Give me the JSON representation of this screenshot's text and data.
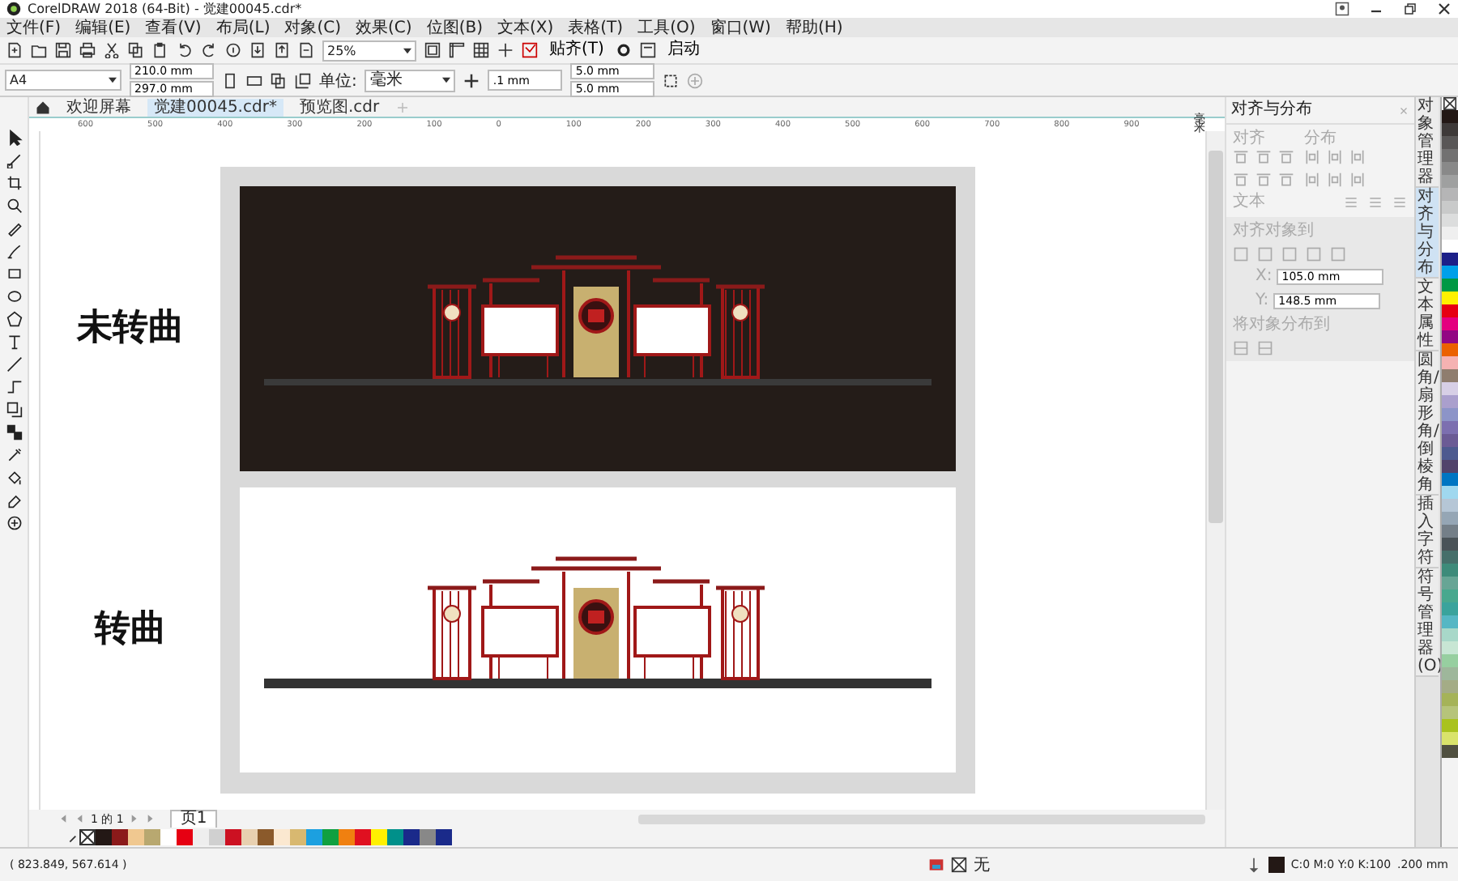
{
  "window": {
    "title": "CorelDRAW 2018 (64-Bit) - 觉建00045.cdr*"
  },
  "menu": [
    "文件(F)",
    "编辑(E)",
    "查看(V)",
    "布局(L)",
    "对象(C)",
    "效果(C)",
    "位图(B)",
    "文本(X)",
    "表格(T)",
    "工具(O)",
    "窗口(W)",
    "帮助(H)"
  ],
  "toolbar": {
    "zoom": "25%",
    "snap": "贴齐(T)",
    "launch": "启动"
  },
  "property_bar": {
    "page_size": "A4",
    "width": "210.0 mm",
    "height": "297.0 mm",
    "units_label": "单位:",
    "units": "毫米",
    "nudge": ".1 mm",
    "dup_x": "5.0 mm",
    "dup_y": "5.0 mm"
  },
  "doc_tabs": [
    {
      "label": "欢迎屏幕",
      "selected": false
    },
    {
      "label": "觉建00045.cdr*",
      "selected": true
    },
    {
      "label": "预览图.cdr",
      "selected": false
    }
  ],
  "ruler": {
    "labels": [
      "600",
      "500",
      "400",
      "300",
      "200",
      "100",
      "0",
      "100",
      "200",
      "300",
      "400",
      "500",
      "600",
      "700",
      "800",
      "900"
    ],
    "unit": "毫米"
  },
  "canvas": {
    "panels": [
      {
        "kind": "dark",
        "label": "未转曲"
      },
      {
        "kind": "light",
        "label": "转曲"
      }
    ]
  },
  "page_nav": {
    "count": "1 的 1",
    "page_tab": "页1"
  },
  "palette": [
    {
      "color": "#231815"
    },
    {
      "color": "#8b1a1a"
    },
    {
      "color": "#f0c890"
    },
    {
      "color": "#b8a870"
    },
    {
      "color": "#ffffff"
    },
    {
      "color": "#e60012"
    },
    {
      "color": "#eeeeee"
    },
    {
      "color": "#d0d0d0"
    },
    {
      "color": "#cc1122"
    },
    {
      "color": "#e8d0b0"
    },
    {
      "color": "#8b5a2b"
    },
    {
      "color": "#fbe8d0"
    },
    {
      "color": "#d8b870"
    },
    {
      "color": "#1ca0e0"
    },
    {
      "color": "#10a040"
    },
    {
      "color": "#f08010"
    },
    {
      "color": "#e01020"
    },
    {
      "color": "#fff000"
    },
    {
      "color": "#00908a"
    },
    {
      "color": "#1a2a8a"
    },
    {
      "color": "#888888"
    },
    {
      "color": "#1a2a8a"
    }
  ],
  "docker": {
    "title": "对齐与分布",
    "align_label": "对齐",
    "distribute_label": "分布",
    "text_label": "文本",
    "align_to_label": "对齐对象到",
    "x_label": "X:",
    "x": "105.0 mm",
    "y_label": "Y:",
    "y": "148.5 mm",
    "distribute_to_label": "将对象分布到"
  },
  "side_tabs": [
    {
      "label": "对象管理器",
      "selected": false
    },
    {
      "label": "对齐与分布",
      "selected": true
    },
    {
      "label": "文本属性",
      "selected": false
    },
    {
      "label": "圆角/扇形角/倒棱角",
      "selected": false
    },
    {
      "label": "插入字符",
      "selected": false
    },
    {
      "label": "符号管理器(O)",
      "selected": false
    }
  ],
  "side_palette": [
    {
      "color": "#231815"
    },
    {
      "color": "#3e3a39"
    },
    {
      "color": "#595757"
    },
    {
      "color": "#727171"
    },
    {
      "color": "#898989"
    },
    {
      "color": "#9fa0a0"
    },
    {
      "color": "#b5b5b6"
    },
    {
      "color": "#c9caca"
    },
    {
      "color": "#dcdddd"
    },
    {
      "color": "#efefef"
    },
    {
      "color": "#ffffff"
    },
    {
      "color": "#1d2088"
    },
    {
      "color": "#00a0e9"
    },
    {
      "color": "#009944"
    },
    {
      "color": "#fff100"
    },
    {
      "color": "#e60012"
    },
    {
      "color": "#e4007f"
    },
    {
      "color": "#920783"
    },
    {
      "color": "#eb6100"
    },
    {
      "color": "#f5b2b2"
    },
    {
      "color": "#8f7d6e"
    },
    {
      "color": "#d7cfe6"
    },
    {
      "color": "#aa9fcd"
    },
    {
      "color": "#8c94c8"
    },
    {
      "color": "#7c6fb0"
    },
    {
      "color": "#6b5b95"
    },
    {
      "color": "#4d5a8f"
    },
    {
      "color": "#51436b"
    },
    {
      "color": "#0075c2"
    },
    {
      "color": "#a0d8ef"
    },
    {
      "color": "#b5c6d6"
    },
    {
      "color": "#95a6b5"
    },
    {
      "color": "#747f88"
    },
    {
      "color": "#4a5358"
    },
    {
      "color": "#456f6a"
    },
    {
      "color": "#3d8b7a"
    },
    {
      "color": "#67a595"
    },
    {
      "color": "#48a88e"
    },
    {
      "color": "#3aa39c"
    },
    {
      "color": "#56b7c4"
    },
    {
      "color": "#a8d8c9"
    },
    {
      "color": "#c8e6d4"
    },
    {
      "color": "#97cfa0"
    },
    {
      "color": "#9eb79b"
    },
    {
      "color": "#a4ac86"
    },
    {
      "color": "#a5b358"
    },
    {
      "color": "#b6c47a"
    },
    {
      "color": "#a9c21e"
    },
    {
      "color": "#d9e36b"
    },
    {
      "color": "#505040"
    }
  ],
  "status": {
    "coords": "( 823.849, 567.614 )",
    "fill": "无",
    "color_info": "C:0 M:0 Y:0 K:100",
    "outline": ".200 mm"
  }
}
